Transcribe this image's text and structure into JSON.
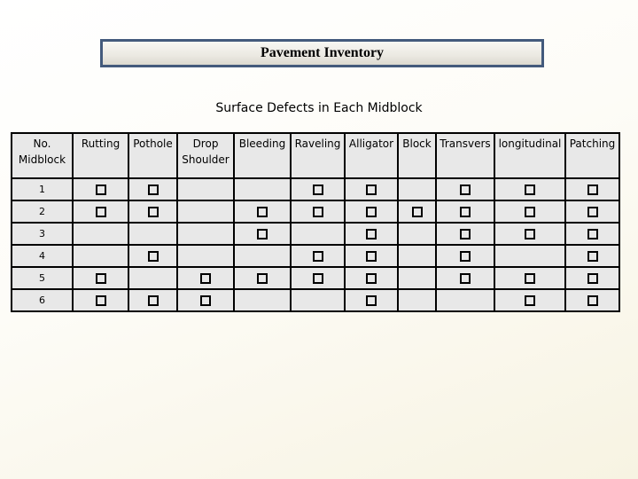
{
  "title": "Pavement Inventory",
  "subtitle": "Surface Defects in Each Midblock",
  "table": {
    "headers": [
      "No. Midblock",
      "Rutting",
      "Pothole",
      "Drop Shoulder",
      "Bleeding",
      "Raveling",
      "Alligator",
      "Block",
      "Transvers",
      "longitudinal",
      "Patching"
    ],
    "checkbox_icon": "checkbox-square-icon",
    "rows": [
      {
        "no": "1",
        "marks": [
          true,
          true,
          false,
          false,
          true,
          true,
          false,
          true,
          true,
          true
        ]
      },
      {
        "no": "2",
        "marks": [
          true,
          true,
          false,
          true,
          true,
          true,
          true,
          true,
          true,
          true
        ]
      },
      {
        "no": "3",
        "marks": [
          false,
          false,
          false,
          true,
          false,
          true,
          false,
          true,
          true,
          true
        ]
      },
      {
        "no": "4",
        "marks": [
          false,
          true,
          false,
          false,
          true,
          true,
          false,
          true,
          false,
          true
        ]
      },
      {
        "no": "5",
        "marks": [
          true,
          false,
          true,
          true,
          true,
          true,
          false,
          true,
          true,
          true
        ]
      },
      {
        "no": "6",
        "marks": [
          true,
          true,
          true,
          false,
          false,
          true,
          false,
          false,
          true,
          true
        ]
      }
    ]
  },
  "colors": {
    "title_border": "#435a7c",
    "table_fill": "#e8e8e8"
  }
}
